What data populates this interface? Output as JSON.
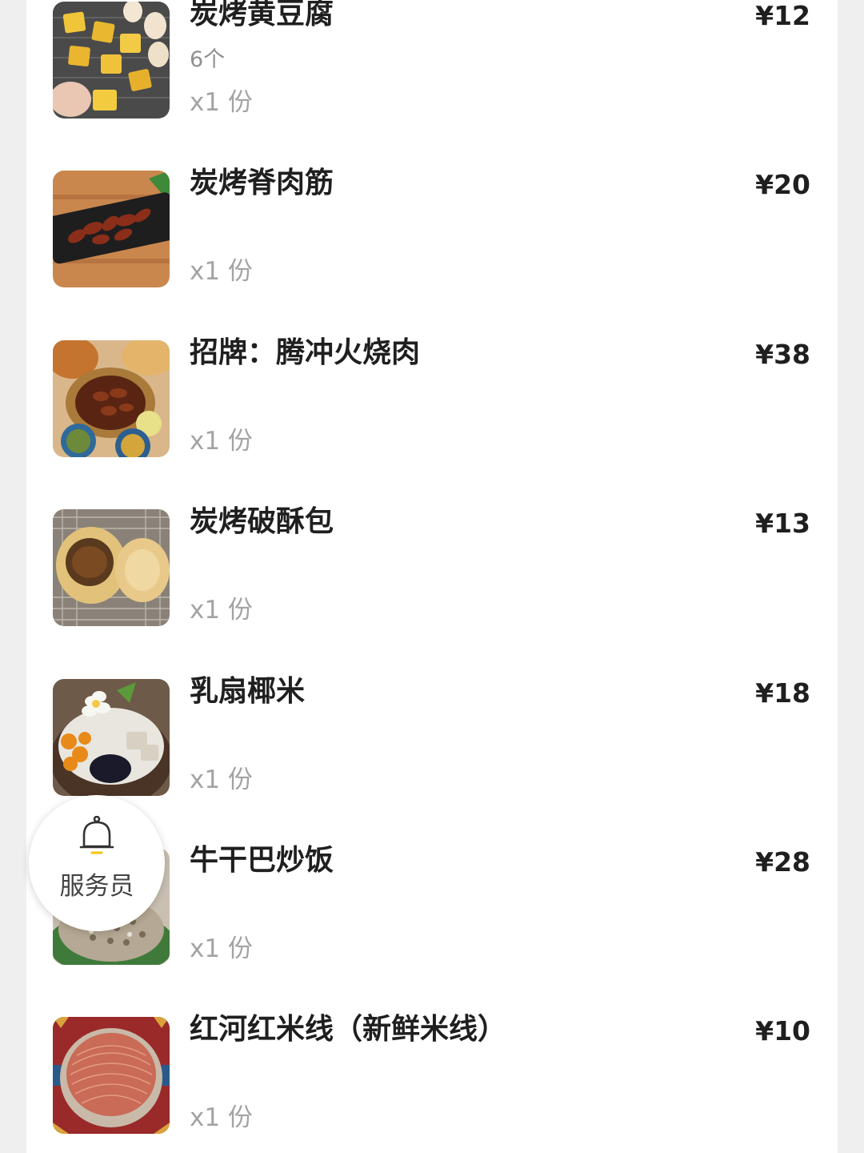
{
  "order_items": [
    {
      "name": "炭烤黄豆腐",
      "spec": "6个",
      "qty": "x1 份",
      "price": "¥12",
      "thumb_icon": "grilled-tofu-photo"
    },
    {
      "name": "炭烤脊肉筋",
      "spec": "",
      "qty": "x1 份",
      "price": "¥20",
      "thumb_icon": "grilled-pork-tendon-photo"
    },
    {
      "name": "招牌：腾冲火烧肉",
      "spec": "",
      "qty": "x1 份",
      "price": "¥38",
      "thumb_icon": "tengchong-roast-pork-photo"
    },
    {
      "name": "炭烤破酥包",
      "spec": "",
      "qty": "x1 份",
      "price": "¥13",
      "thumb_icon": "grilled-bun-photo"
    },
    {
      "name": "乳扇椰米",
      "spec": "",
      "qty": "x1 份",
      "price": "¥18",
      "thumb_icon": "coconut-dessert-photo"
    },
    {
      "name": "牛干巴炒饭",
      "spec": "",
      "qty": "x1 份",
      "price": "¥28",
      "thumb_icon": "beef-fried-rice-photo"
    },
    {
      "name": "红河红米线（新鲜米线）",
      "spec": "",
      "qty": "x1 份",
      "price": "¥10",
      "thumb_icon": "red-rice-noodle-photo"
    }
  ],
  "waiter_button": {
    "label": "服务员",
    "icon": "bell-icon"
  },
  "colors": {
    "page_background": "#efefef",
    "card_background": "#ffffff",
    "name_text": "#1f1f1f",
    "secondary_text": "#a3a3a3",
    "bell_accent": "#f5c400"
  }
}
